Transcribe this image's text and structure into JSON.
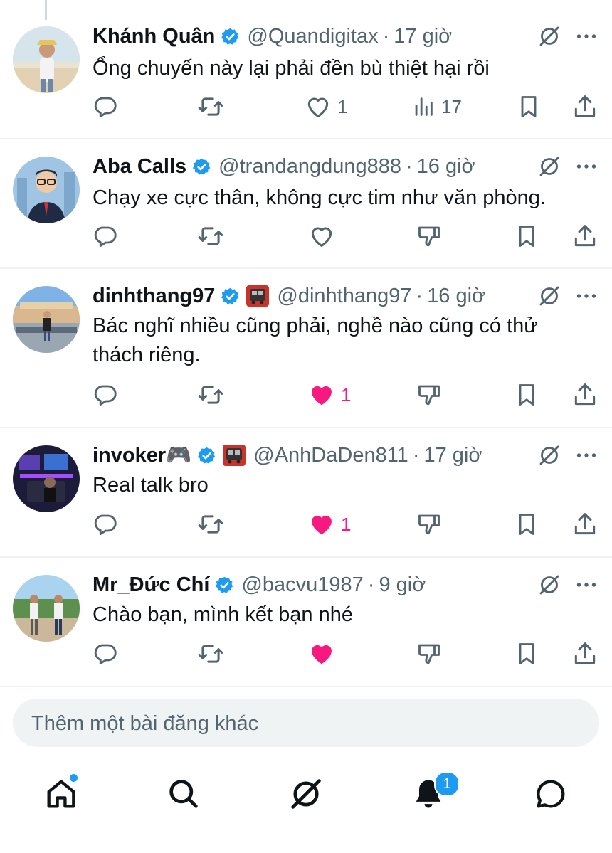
{
  "replies": [
    {
      "name": "Khánh Quân",
      "handle": "@Quandigitax",
      "separator": "·",
      "time": "17 giờ",
      "text": "Ổng chuyến này lại phải đền bù thiệt hại rồi",
      "actions": {
        "like_count": "1",
        "like_state": "not-liked",
        "views_count": "17",
        "has_views": true
      }
    },
    {
      "name": "Aba Calls",
      "handle": "@trandangdung888",
      "separator": "·",
      "time": "16 giờ",
      "text": "Chạy xe cực thân, không cực tim như văn phòng.",
      "actions": {
        "like_count": "",
        "like_state": "not-liked",
        "has_views": false
      }
    },
    {
      "name": "dinhthang97",
      "handle": "@dinhthang97",
      "separator": "·",
      "time": "16 giờ",
      "text": "Bác nghĩ nhiều cũng phải, nghề nào cũng có thử thách riêng.",
      "actions": {
        "like_count": "1",
        "like_state": "liked",
        "has_views": false
      }
    },
    {
      "name": "invoker🎮",
      "handle": "@AnhDaDen811",
      "separator": "·",
      "time": "17 giờ",
      "text": "Real talk bro",
      "actions": {
        "like_count": "1",
        "like_state": "liked",
        "has_views": false
      }
    },
    {
      "name": "Mr_Đức Chí",
      "handle": "@bacvu1987",
      "separator": "·",
      "time": "9 giờ",
      "text": "Chào bạn, mình kết bạn nhé",
      "actions": {
        "like_count": "",
        "like_state": "liked",
        "has_views": false
      }
    }
  ],
  "composer": {
    "placeholder": "Thêm một bài đăng khác"
  },
  "bottom_nav": {
    "items": [
      "home-icon",
      "search-icon",
      "grok-icon",
      "bell-icon",
      "messages-icon"
    ],
    "notifications_badge": "1"
  },
  "colors": {
    "text": "#0f1419",
    "secondary": "#536471",
    "accent": "#1d9bf0",
    "like": "#f91880",
    "divider": "#eff3f4"
  }
}
